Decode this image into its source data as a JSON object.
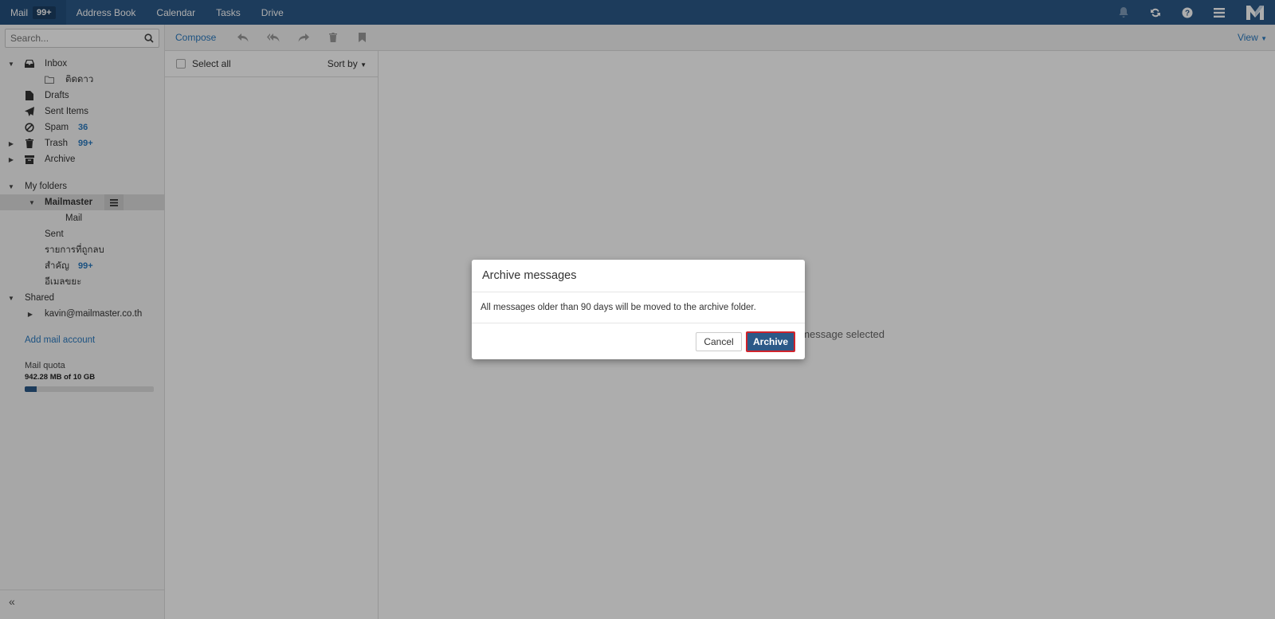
{
  "topnav": {
    "mail_label": "Mail",
    "mail_badge": "99+",
    "address_book": "Address Book",
    "calendar": "Calendar",
    "tasks": "Tasks",
    "drive": "Drive",
    "icons": [
      "bell-icon",
      "refresh-icon",
      "help-icon",
      "menu-icon",
      "mailmaster-logo"
    ]
  },
  "sidebar": {
    "search_placeholder": "Search...",
    "folders": [
      {
        "label": "Inbox",
        "icon": "inbox-icon"
      },
      {
        "label": "ติดดาว",
        "icon": "folder-icon"
      },
      {
        "label": "Drafts",
        "icon": "file-icon"
      },
      {
        "label": "Sent Items",
        "icon": "paper-plane-icon"
      },
      {
        "label": "Spam",
        "count": "36",
        "icon": "ban-icon"
      },
      {
        "label": "Trash",
        "count": "99+",
        "icon": "trash-icon"
      },
      {
        "label": "Archive",
        "icon": "archive-icon"
      }
    ],
    "my_folders_title": "My folders",
    "my_folders": [
      {
        "label": "Mailmaster"
      },
      {
        "label": "Mail"
      },
      {
        "label": "Sent"
      },
      {
        "label": "รายการที่ถูกลบ"
      },
      {
        "label": "สำคัญ",
        "count": "99+"
      },
      {
        "label": "อีเมลขยะ"
      }
    ],
    "shared_title": "Shared",
    "shared": [
      {
        "label": "kavin@mailmaster.co.th"
      }
    ],
    "add_account": "Add mail account",
    "quota_label": "Mail quota",
    "quota_value": "942.28 MB of 10 GB",
    "quota_fraction": 0.092
  },
  "toolbar": {
    "compose": "Compose",
    "icons": [
      "reply-icon",
      "reply-all-icon",
      "forward-icon",
      "delete-icon",
      "bookmark-icon"
    ],
    "view": "View"
  },
  "message_list": {
    "select_all": "Select all",
    "sort_by": "Sort by"
  },
  "reading_pane": {
    "empty_text": "No message selected"
  },
  "modal": {
    "title": "Archive messages",
    "body": "All messages older than 90 days will be moved to the archive folder.",
    "cancel": "Cancel",
    "archive": "Archive"
  },
  "colors": {
    "topbar": "#2c5988",
    "accent": "#2a79bf",
    "highlight_border": "#d0232b"
  }
}
